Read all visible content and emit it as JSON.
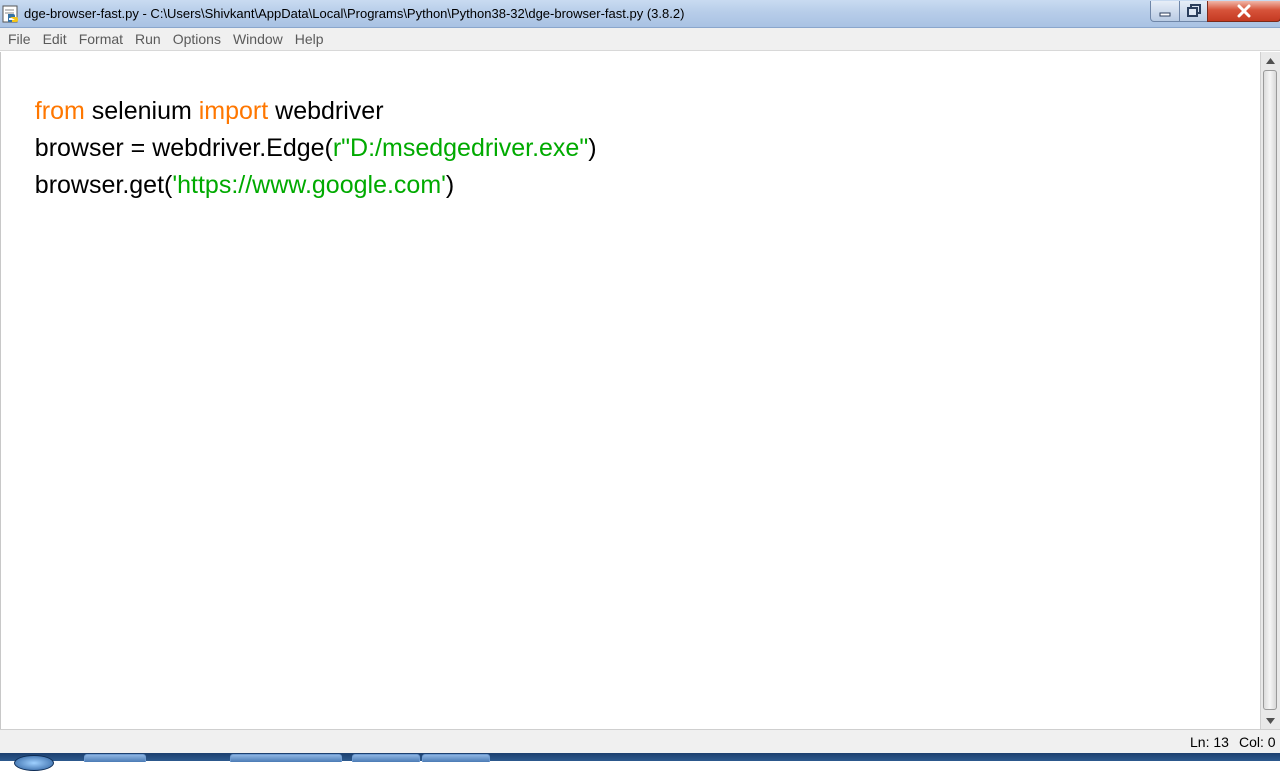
{
  "window": {
    "title": "dge-browser-fast.py - C:\\Users\\Shivkant\\AppData\\Local\\Programs\\Python\\Python38-32\\dge-browser-fast.py (3.8.2)",
    "app_icon": "python-idle-icon",
    "controls": [
      "minimize-icon",
      "restore-icon",
      "close-icon"
    ]
  },
  "menubar": {
    "items": [
      "File",
      "Edit",
      "Format",
      "Run",
      "Options",
      "Window",
      "Help"
    ]
  },
  "editor": {
    "lines": [
      [
        {
          "t": "from",
          "c": "kw"
        },
        {
          "t": " selenium ",
          "c": ""
        },
        {
          "t": "import",
          "c": "kw"
        },
        {
          "t": " webdriver",
          "c": ""
        }
      ],
      [
        {
          "t": "browser = webdriver.Edge(",
          "c": ""
        },
        {
          "t": "r\"D:/msedgedriver.exe\"",
          "c": "str"
        },
        {
          "t": ")",
          "c": ""
        }
      ],
      [
        {
          "t": "browser.get(",
          "c": ""
        },
        {
          "t": "'https://www.google.com'",
          "c": "str"
        },
        {
          "t": ")",
          "c": ""
        }
      ]
    ],
    "colors": {
      "keyword": "#ff7700",
      "string": "#00aa00",
      "default": "#000000"
    }
  },
  "statusbar": {
    "line": "Ln: 13",
    "col": "Col: 0"
  }
}
